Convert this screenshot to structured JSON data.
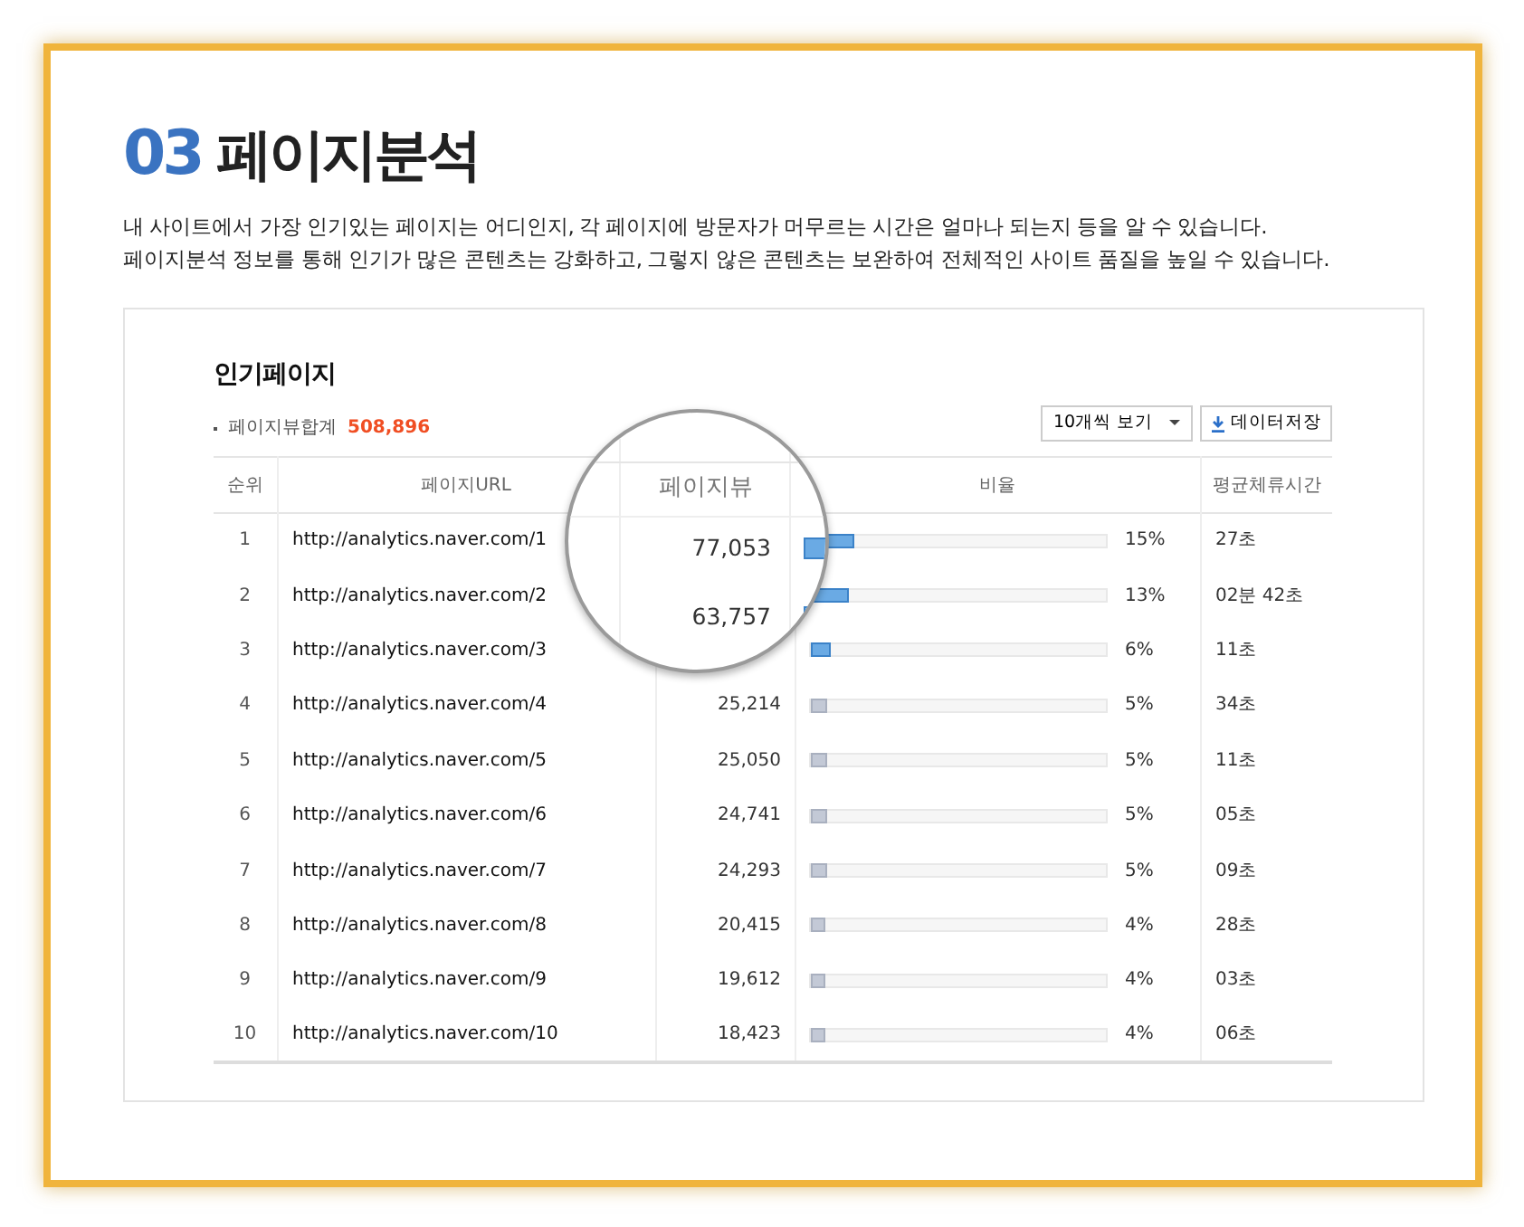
{
  "heading": {
    "number": "03",
    "title": "페이지분석"
  },
  "description": [
    "내 사이트에서 가장 인기있는 페이지는 어디인지, 각 페이지에 방문자가 머무르는 시간은 얼마나 되는지 등을 알 수 있습니다.",
    "페이지분석 정보를 통해 인기가 많은 콘텐츠는 강화하고, 그렇지 않은 콘텐츠는 보완하여 전체적인 사이트 품질을 높일 수 있습니다."
  ],
  "panel": {
    "title": "인기페이지",
    "total_label": "페이지뷰합계",
    "total_value": "508,896",
    "page_size": "10개씩 보기",
    "save_button": "데이터저장"
  },
  "table": {
    "columns": [
      "순위",
      "페이지URL",
      "비율",
      "평균체류시간"
    ],
    "rows": [
      {
        "rank": "1",
        "url": "http://analytics.naver.com/1",
        "level": 0.15,
        "share": "15%",
        "time": "27초",
        "highlighted": true
      },
      {
        "rank": "2",
        "url": "http://analytics.naver.com/2",
        "level": 0.13,
        "share": "13%",
        "time": "02분 42초",
        "highlighted": true
      },
      {
        "rank": "3",
        "url": "http://analytics.naver.com/3",
        "level": 0.07,
        "share": "6%",
        "time": "11초",
        "highlighted": true
      },
      {
        "rank": "4",
        "url": "http://analytics.naver.com/4",
        "views": "25,214",
        "level": 0.06,
        "share": "5%",
        "time": "34초",
        "highlighted": false
      },
      {
        "rank": "5",
        "url": "http://analytics.naver.com/5",
        "views": "25,050",
        "level": 0.06,
        "share": "5%",
        "time": "11초",
        "highlighted": false
      },
      {
        "rank": "6",
        "url": "http://analytics.naver.com/6",
        "views": "24,741",
        "level": 0.06,
        "share": "5%",
        "time": "05초",
        "highlighted": false
      },
      {
        "rank": "7",
        "url": "http://analytics.naver.com/7",
        "views": "24,293",
        "level": 0.06,
        "share": "5%",
        "time": "09초",
        "highlighted": false
      },
      {
        "rank": "8",
        "url": "http://analytics.naver.com/8",
        "views": "20,415",
        "level": 0.05,
        "share": "4%",
        "time": "28초",
        "highlighted": false
      },
      {
        "rank": "9",
        "url": "http://analytics.naver.com/9",
        "views": "19,612",
        "level": 0.05,
        "share": "4%",
        "time": "03초",
        "highlighted": false
      },
      {
        "rank": "10",
        "url": "http://analytics.naver.com/10",
        "views": "18,423",
        "level": 0.05,
        "share": "4%",
        "time": "06초",
        "highlighted": false
      }
    ]
  },
  "magnifier": {
    "header": "페이지뷰",
    "values": [
      "77,053",
      "63,757"
    ]
  }
}
